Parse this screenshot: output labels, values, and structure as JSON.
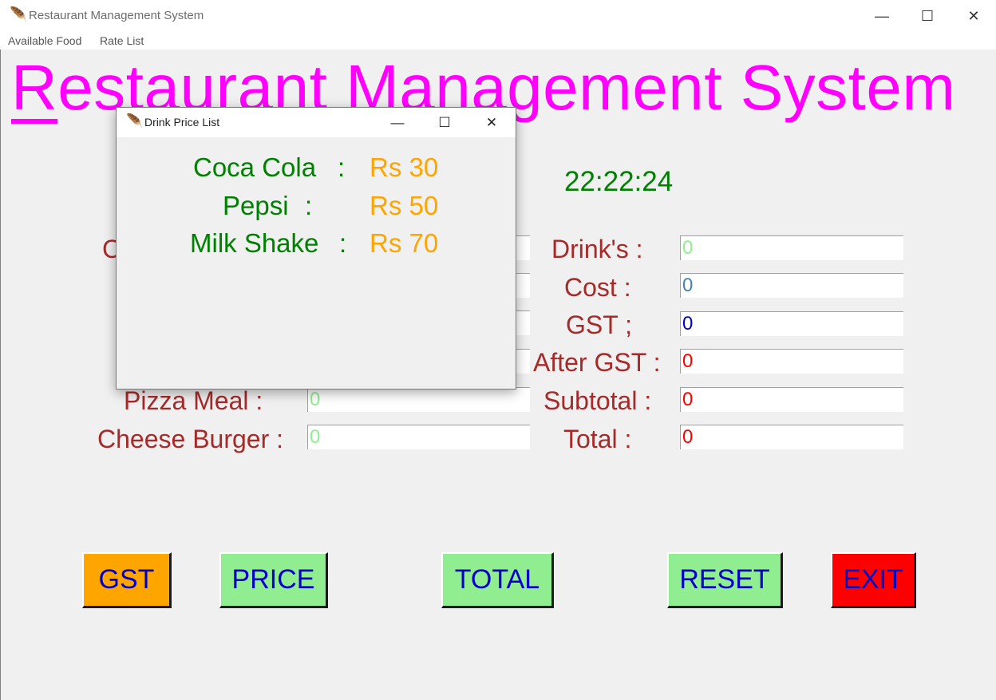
{
  "window": {
    "title": "Restaurant Management System",
    "minimize": "—",
    "maximize": "☐",
    "close": "✕"
  },
  "menubar": {
    "items": [
      "Available Food",
      "Rate List"
    ]
  },
  "heading": {
    "first_letter": "R",
    "rest": "estaurant Management System"
  },
  "clock": "22:22:24",
  "left_form": {
    "labels": [
      "Pizza Meal :",
      "Cheese Burger :"
    ],
    "values": [
      "0",
      "0"
    ]
  },
  "right_form": {
    "labels": [
      "Drink's :",
      "Cost :",
      "GST ;",
      "After GST :",
      "Subtotal :",
      "Total :"
    ],
    "values": [
      "0",
      "0",
      "0",
      "0",
      "0",
      "0"
    ]
  },
  "buttons": {
    "gst": "GST",
    "price": "PRICE",
    "total": "TOTAL",
    "reset": "RESET",
    "exit": "EXIT"
  },
  "popup": {
    "title": "Drink Price List",
    "separator": ":",
    "items": [
      {
        "name": "Coca Cola",
        "price": "Rs 30"
      },
      {
        "name": "Pepsi",
        "price": "Rs 50"
      },
      {
        "name": "Milk Shake",
        "price": "Rs 70"
      }
    ]
  },
  "colors": {
    "heading": "#ff00ff",
    "labels": "#a52a2a",
    "clock": "#008000",
    "drink_names": "#008000",
    "drink_prices": "#ffa500",
    "button_text": "#0000cd",
    "gst_button": "#ffa500",
    "green_buttons": "#90ee90",
    "exit_button": "#ff0000",
    "entry_drinks": "#90ee90",
    "entry_cost": "#4682b4",
    "entry_gst": "#0000cd",
    "entry_after_gst": "#ff0000",
    "entry_subtotal": "#ff0000",
    "entry_total": "#ff0000"
  },
  "icons": {
    "app_icon": "feather-icon",
    "popup_icon": "feather-icon"
  }
}
